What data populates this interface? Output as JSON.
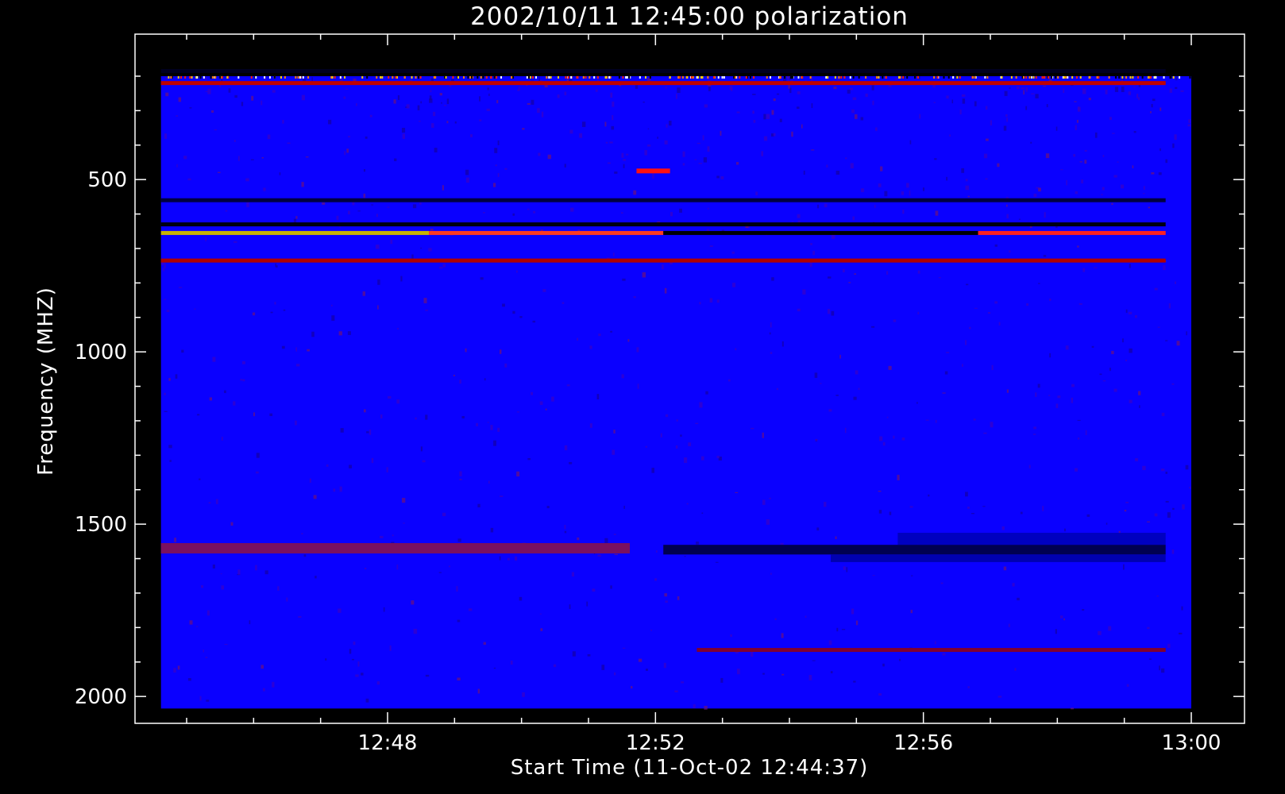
{
  "chart_data": {
    "type": "heatmap",
    "title": "2002/10/11 12:45:00 polarization",
    "xlabel": "Start Time (11-Oct-02 12:44:37)",
    "ylabel": "Frequency (MHZ)",
    "x_ticks": [
      "12:48",
      "12:52",
      "12:56",
      "13:00"
    ],
    "x_tick_minutes": [
      3.383,
      7.383,
      11.383,
      15.383
    ],
    "x_minor_ticks_minutes": [
      0.383,
      1.383,
      2.383,
      4.383,
      5.383,
      6.383,
      8.383,
      9.383,
      10.383,
      12.383,
      13.383,
      14.383
    ],
    "y_ticks": [
      500,
      1000,
      1500,
      2000
    ],
    "y_minor_ticks": [
      200,
      300,
      400,
      600,
      700,
      800,
      900,
      1100,
      1200,
      1300,
      1400,
      1600,
      1700,
      1800,
      1900
    ],
    "ylim": [
      2078,
      78
    ],
    "data_time_range": [
      "12:44:37",
      "13:00:00"
    ],
    "data_freq_range": [
      200,
      2035
    ],
    "y_inverted": true,
    "grid": false,
    "colormap": [
      "#000000",
      "#0000ff",
      "#ff0000",
      "#ffd700"
    ],
    "background_color": "#0a00ff",
    "features": [
      {
        "kind": "line",
        "freq": 185,
        "t_start": 0,
        "t_end": 15.0,
        "color": "#000020"
      },
      {
        "kind": "line",
        "freq": 220,
        "t_start": 0,
        "t_end": 15.0,
        "color": "#c00000"
      },
      {
        "kind": "line",
        "freq": 560,
        "t_start": 0,
        "t_end": 15.0,
        "color": "#000040"
      },
      {
        "kind": "line",
        "freq": 630,
        "t_start": 0,
        "t_end": 15.0,
        "color": "#000010"
      },
      {
        "kind": "line",
        "freq": 655,
        "t_start": 0,
        "t_end": 4.0,
        "color": "#c8b400"
      },
      {
        "kind": "line",
        "freq": 655,
        "t_start": 4.0,
        "t_end": 7.5,
        "color": "#ff3a20"
      },
      {
        "kind": "line",
        "freq": 655,
        "t_start": 7.5,
        "t_end": 12.2,
        "color": "#000000"
      },
      {
        "kind": "line",
        "freq": 655,
        "t_start": 12.2,
        "t_end": 15.0,
        "color": "#ff2020"
      },
      {
        "kind": "line",
        "freq": 735,
        "t_start": 0,
        "t_end": 15.0,
        "color": "#b00000"
      },
      {
        "kind": "line",
        "freq": 1865,
        "t_start": 8.0,
        "t_end": 15.0,
        "color": "#800030"
      },
      {
        "kind": "blob",
        "freq": 475,
        "t_start": 7.1,
        "t_end": 7.6,
        "color": "#ff1010"
      },
      {
        "kind": "band",
        "freq_start": 1555,
        "freq_end": 1585,
        "t_start": 0,
        "t_end": 7.0,
        "color": "#7a1060"
      },
      {
        "kind": "band",
        "freq_start": 1525,
        "freq_end": 1560,
        "t_start": 11.0,
        "t_end": 15.0,
        "color": "#0000c0"
      },
      {
        "kind": "band",
        "freq_start": 1560,
        "freq_end": 1588,
        "t_start": 7.5,
        "t_end": 15.0,
        "color": "#000050"
      },
      {
        "kind": "band",
        "freq_start": 1588,
        "freq_end": 1610,
        "t_start": 10.0,
        "t_end": 15.0,
        "color": "#0000b0"
      }
    ]
  }
}
